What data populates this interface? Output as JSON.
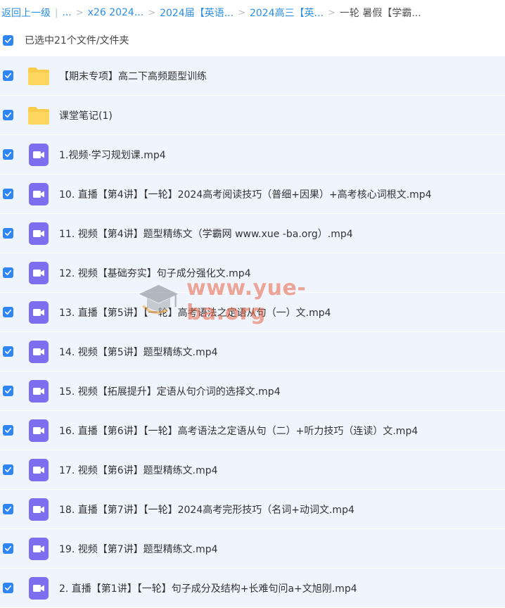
{
  "breadcrumb": {
    "back": "返回上一级",
    "ellipsis": "...",
    "items": [
      "x26 2024...",
      "2024届【英语...",
      "2024高三【英..."
    ],
    "current": "一轮 暑假【学霸..."
  },
  "selection": {
    "label": "已选中21个文件/文件夹"
  },
  "files": [
    {
      "type": "folder",
      "name": "【期末专项】高二下高频题型训练"
    },
    {
      "type": "folder",
      "name": "课堂笔记(1)"
    },
    {
      "type": "video",
      "name": "1.视频·学习规划课.mp4"
    },
    {
      "type": "video",
      "name": "10. 直播【第4讲】【一轮】2024高考阅读技巧（普细+因果）+高考核心词根文.mp4"
    },
    {
      "type": "video",
      "name": "11. 视频【第4讲】题型精练文（学霸网 www.xue -ba.org）.mp4"
    },
    {
      "type": "video",
      "name": "12. 视频【基础夯实】句子成分强化文.mp4"
    },
    {
      "type": "video",
      "name": "13. 直播【第5讲】【一轮】高考语法之定语从句（一）文.mp4"
    },
    {
      "type": "video",
      "name": "14. 视频【第5讲】题型精练文.mp4"
    },
    {
      "type": "video",
      "name": "15. 视频【拓展提升】定语从句介词的选择文.mp4"
    },
    {
      "type": "video",
      "name": "16. 直播【第6讲】【一轮】高考语法之定语从句（二）+听力技巧（连读）文.mp4"
    },
    {
      "type": "video",
      "name": "17. 视频【第6讲】题型精练文.mp4"
    },
    {
      "type": "video",
      "name": "18. 直播【第7讲】【一轮】2024高考完形技巧（名词+动词文.mp4"
    },
    {
      "type": "video",
      "name": "19. 视频【第7讲】题型精练文.mp4"
    },
    {
      "type": "video",
      "name": "2. 直播【第1讲】【一轮】句子成分及结构+长难句问a+文旭刚.mp4"
    }
  ],
  "watermark": {
    "text": "www.yue-ba.org"
  },
  "colors": {
    "accent": "#2f86f0",
    "link": "#2a8ee6",
    "row_bg": "#f0f5fd",
    "folder": "#fbcb4c",
    "video": "#7d6ef0"
  },
  "icons": {
    "checkbox": "check-icon",
    "folder": "folder-icon",
    "video": "video-file-icon",
    "watermark": "graduation-cap-icon"
  }
}
